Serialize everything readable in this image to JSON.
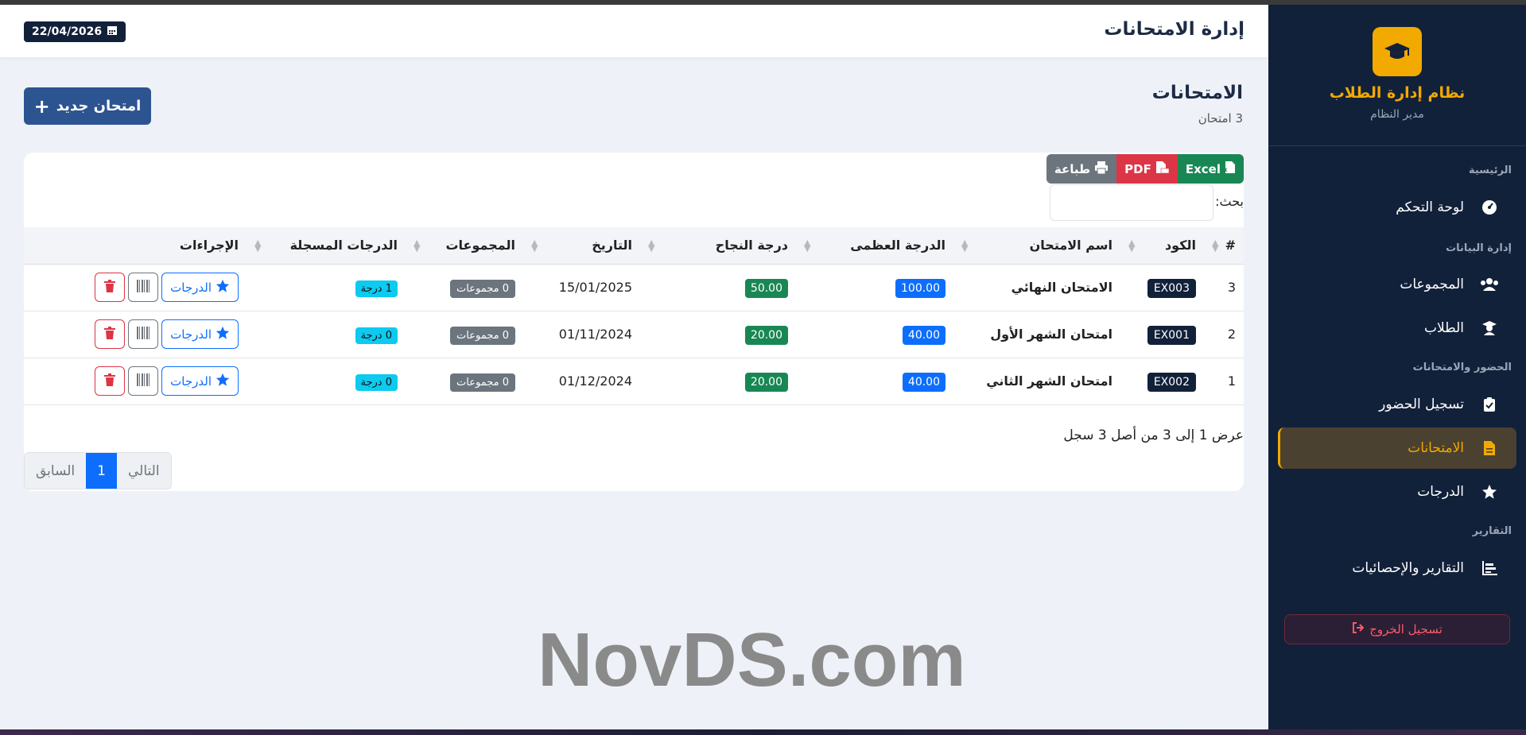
{
  "app": {
    "brand_title": "نظام إدارة الطلاب",
    "brand_subtitle": "مدير النظام",
    "accent": "#f2a900",
    "sidebar_bg": "#12213a"
  },
  "sidebar": {
    "sections": [
      {
        "label": "الرئيسية"
      },
      {
        "label": "إدارة البيانات"
      },
      {
        "label": "الحضور والامتحانات"
      },
      {
        "label": "التقارير"
      }
    ],
    "items": [
      {
        "label": "لوحة التحكم",
        "icon": "dashboard-icon"
      },
      {
        "label": "المجموعات",
        "icon": "users-icon"
      },
      {
        "label": "الطلاب",
        "icon": "student-icon"
      },
      {
        "label": "تسجيل الحضور",
        "icon": "clipboard-check-icon"
      },
      {
        "label": "الامتحانات",
        "icon": "file-icon",
        "active": true
      },
      {
        "label": "الدرجات",
        "icon": "star-icon"
      },
      {
        "label": "التقارير والإحصائيات",
        "icon": "chart-icon"
      }
    ],
    "logout_label": "تسجيل الخروج"
  },
  "header": {
    "title": "إدارة الامتحانات",
    "date": "22/04/2026"
  },
  "page": {
    "title": "الامتحانات",
    "subtitle": "3 امتحان",
    "new_button": "امتحان جديد"
  },
  "toolbar": {
    "excel": "Excel",
    "pdf": "PDF",
    "print": "طباعة",
    "search_label": "بحث:"
  },
  "table": {
    "headers": [
      "#",
      "الكود",
      "اسم الامتحان",
      "الدرجة العظمى",
      "درجة النجاح",
      "التاريخ",
      "المجموعات",
      "الدرجات المسجلة",
      "الإجراءات"
    ],
    "rows": [
      {
        "num": "3",
        "code": "EX003",
        "name": "الامتحان النهائي",
        "max": "100.00",
        "pass": "50.00",
        "date": "15/01/2025",
        "groups": "0 مجموعات",
        "registered": "1 درجة",
        "grades_btn": "الدرجات"
      },
      {
        "num": "2",
        "code": "EX001",
        "name": "امتحان الشهر الأول",
        "max": "40.00",
        "pass": "20.00",
        "date": "01/11/2024",
        "groups": "0 مجموعات",
        "registered": "0 درجة",
        "grades_btn": "الدرجات"
      },
      {
        "num": "1",
        "code": "EX002",
        "name": "امتحان الشهر الثاني",
        "max": "40.00",
        "pass": "20.00",
        "date": "01/12/2024",
        "groups": "0 مجموعات",
        "registered": "0 درجة",
        "grades_btn": "الدرجات"
      }
    ]
  },
  "footer": {
    "info": "عرض 1 إلى 3 من أصل 3 سجل",
    "prev": "السابق",
    "page": "1",
    "next": "التالي"
  },
  "watermark": "NovDS.com"
}
